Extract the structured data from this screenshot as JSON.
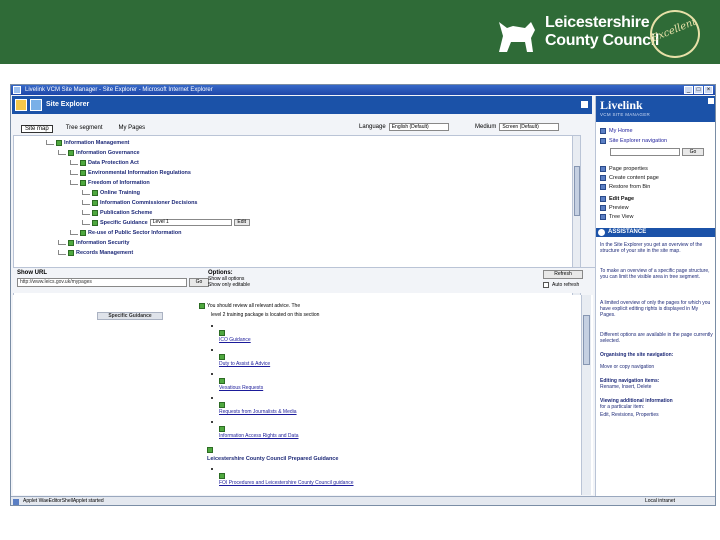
{
  "header": {
    "org_line1": "Leicestershire",
    "org_line2": "County Council",
    "seal_text": "Excellent"
  },
  "window": {
    "title": "Livelink VCM Site Manager - Site Explorer - Microsoft Internet Explorer",
    "buttons": [
      "_",
      "□",
      "×"
    ]
  },
  "explorer": {
    "title": "Site Explorer",
    "tabs": [
      "Site map",
      "Tree segment",
      "My Pages"
    ],
    "language_label": "Language",
    "language_value": "English (Default)",
    "medium_label": "Medium",
    "medium_value": "Screen (Default)",
    "tree": [
      {
        "label": "Information Management"
      },
      {
        "label": "Information Governance"
      },
      {
        "label": "Data Protection Act"
      },
      {
        "label": "Environmental Information Regulations"
      },
      {
        "label": "Freedom of Information"
      },
      {
        "label": "Online Training"
      },
      {
        "label": "Information Commissioner Decisions"
      },
      {
        "label": "Publication Scheme"
      },
      {
        "label": "Specific Guidance"
      },
      {
        "label": "Re-use of Public Sector Information"
      },
      {
        "label": "Information Security"
      },
      {
        "label": "Records Management"
      }
    ],
    "inline_select": "Level 1",
    "inline_btn": "Edit",
    "show_url_label": "Show URL",
    "url_value": "http://www.leics.gov.uk/mypages",
    "go_label": "Go",
    "options_label": "Options:",
    "options_line1": "Show all options",
    "options_line2": "Show only editable",
    "refresh_label": "Refresh",
    "autorefresh_label": "Auto refresh"
  },
  "content": {
    "tab_label": "Specific Guidance",
    "intro": "You should review all relevant advice. The",
    "intro2": "level 2 training package is located on this section",
    "links": [
      "ICO Guidance",
      "Duty to Assist & Advice",
      "Vexatious Requests",
      "Requests from Journalists & Media",
      "Information Access Rights and Data"
    ],
    "section_title": "Leicestershire County Council Prepared Guidance",
    "section_link": "FOI Procedures and Leicestershire County Council guidance"
  },
  "sidebar": {
    "brand": "Livelink",
    "brand_sub": "VCM SITE MANAGER",
    "items": [
      {
        "label": "My Home"
      },
      {
        "label": "Site Explorer navigation"
      },
      {
        "label": "Page properties"
      },
      {
        "label": "Create content page"
      },
      {
        "label": "Restore from Bin"
      },
      {
        "label": "Edit Page"
      },
      {
        "label": "Preview"
      },
      {
        "label": "Tree View"
      }
    ],
    "search_value": "",
    "search_btn": "Go",
    "assistance_title": "ASSISTANCE",
    "assist": [
      "In the Site Explorer you get an overview of the structure of your site in the site map.",
      "To make an overview of a specific page structure, you can limit the visible area in tree segment.",
      "A limited overview of only the pages for which you have explicit editing rights is displayed in My Pages.",
      "Different options are available in the page currently selected."
    ],
    "organising_title": "Organising the site navigation:",
    "organising_text": "Move or copy navigation",
    "editing_title": "Editing navigation items:",
    "editing_links": "Rename, Insert, Delete",
    "viewing_title": "Viewing additional information",
    "viewing_text": "for a particular item:",
    "viewing_links": "Edit, Revisions, Properties"
  },
  "status": {
    "left": "Applet WaeEditorShellApplet started",
    "right": "Local intranet"
  }
}
